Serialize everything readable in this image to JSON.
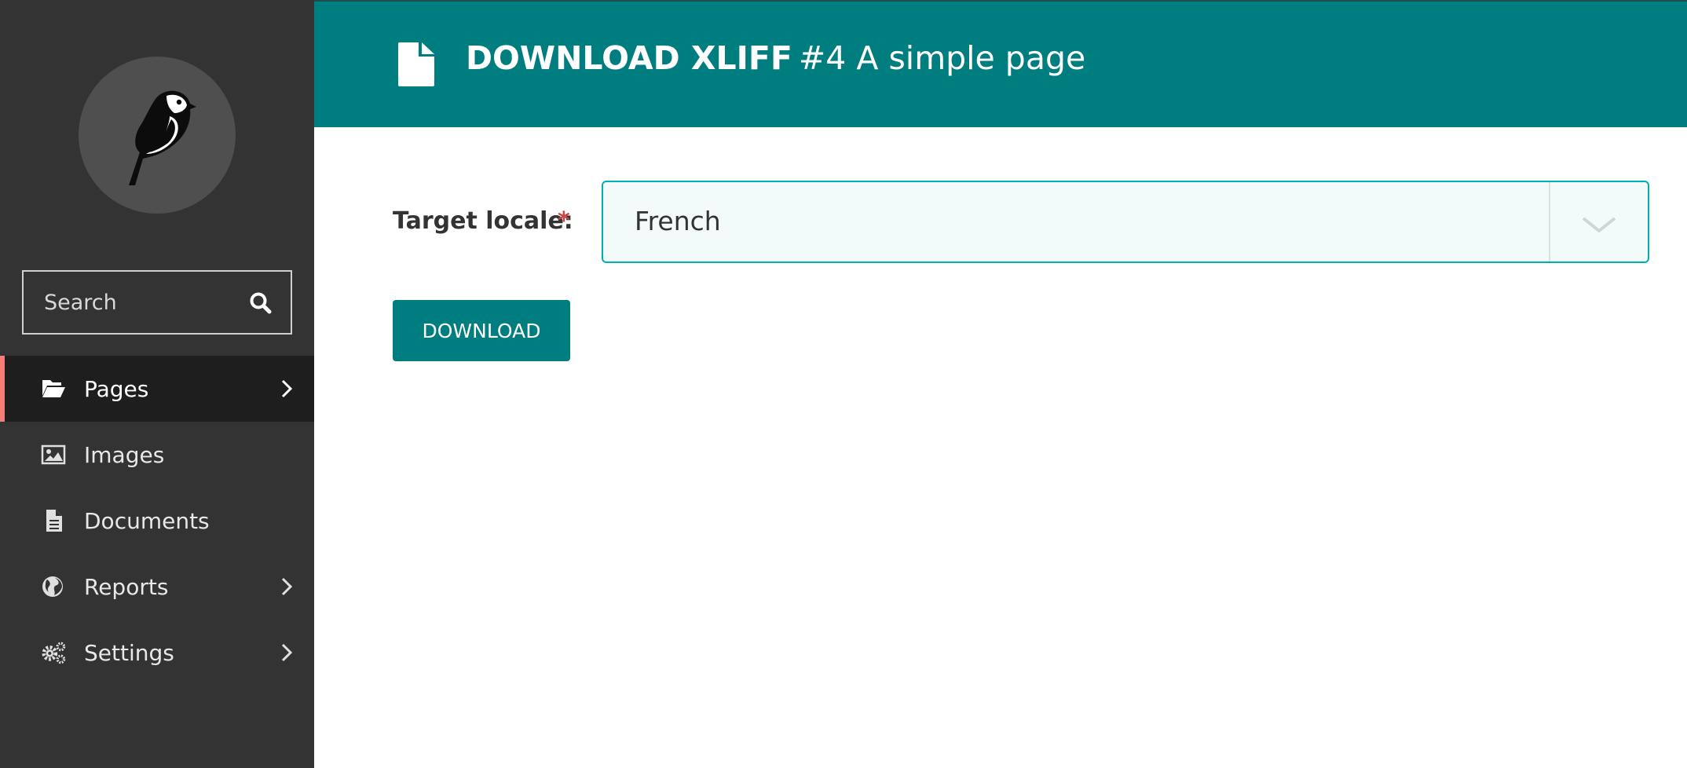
{
  "sidebar": {
    "logo_icon": "wagtail-bird-logo",
    "search": {
      "placeholder": "Search",
      "icon": "search-icon"
    },
    "items": [
      {
        "label": "Pages",
        "icon": "folder-open-icon",
        "has_submenu": true,
        "active": true
      },
      {
        "label": "Images",
        "icon": "image-icon",
        "has_submenu": false,
        "active": false
      },
      {
        "label": "Documents",
        "icon": "document-icon",
        "has_submenu": false,
        "active": false
      },
      {
        "label": "Reports",
        "icon": "globe-icon",
        "has_submenu": true,
        "active": false
      },
      {
        "label": "Settings",
        "icon": "cogs-icon",
        "has_submenu": true,
        "active": false
      }
    ]
  },
  "header": {
    "icon": "document-icon",
    "title": "DOWNLOAD XLIFF",
    "subtitle": "#4 A simple page"
  },
  "form": {
    "target_locale_label": "Target locale:",
    "required_marker": "*",
    "target_locale_value": "French",
    "download_label": "DOWNLOAD"
  },
  "colors": {
    "sidebar_bg": "#333333",
    "sidebar_active_bg": "#1e1e1e",
    "active_accent": "#f37e77",
    "primary": "#007d7e",
    "select_border": "#00b0b1",
    "required": "#cd4444"
  }
}
